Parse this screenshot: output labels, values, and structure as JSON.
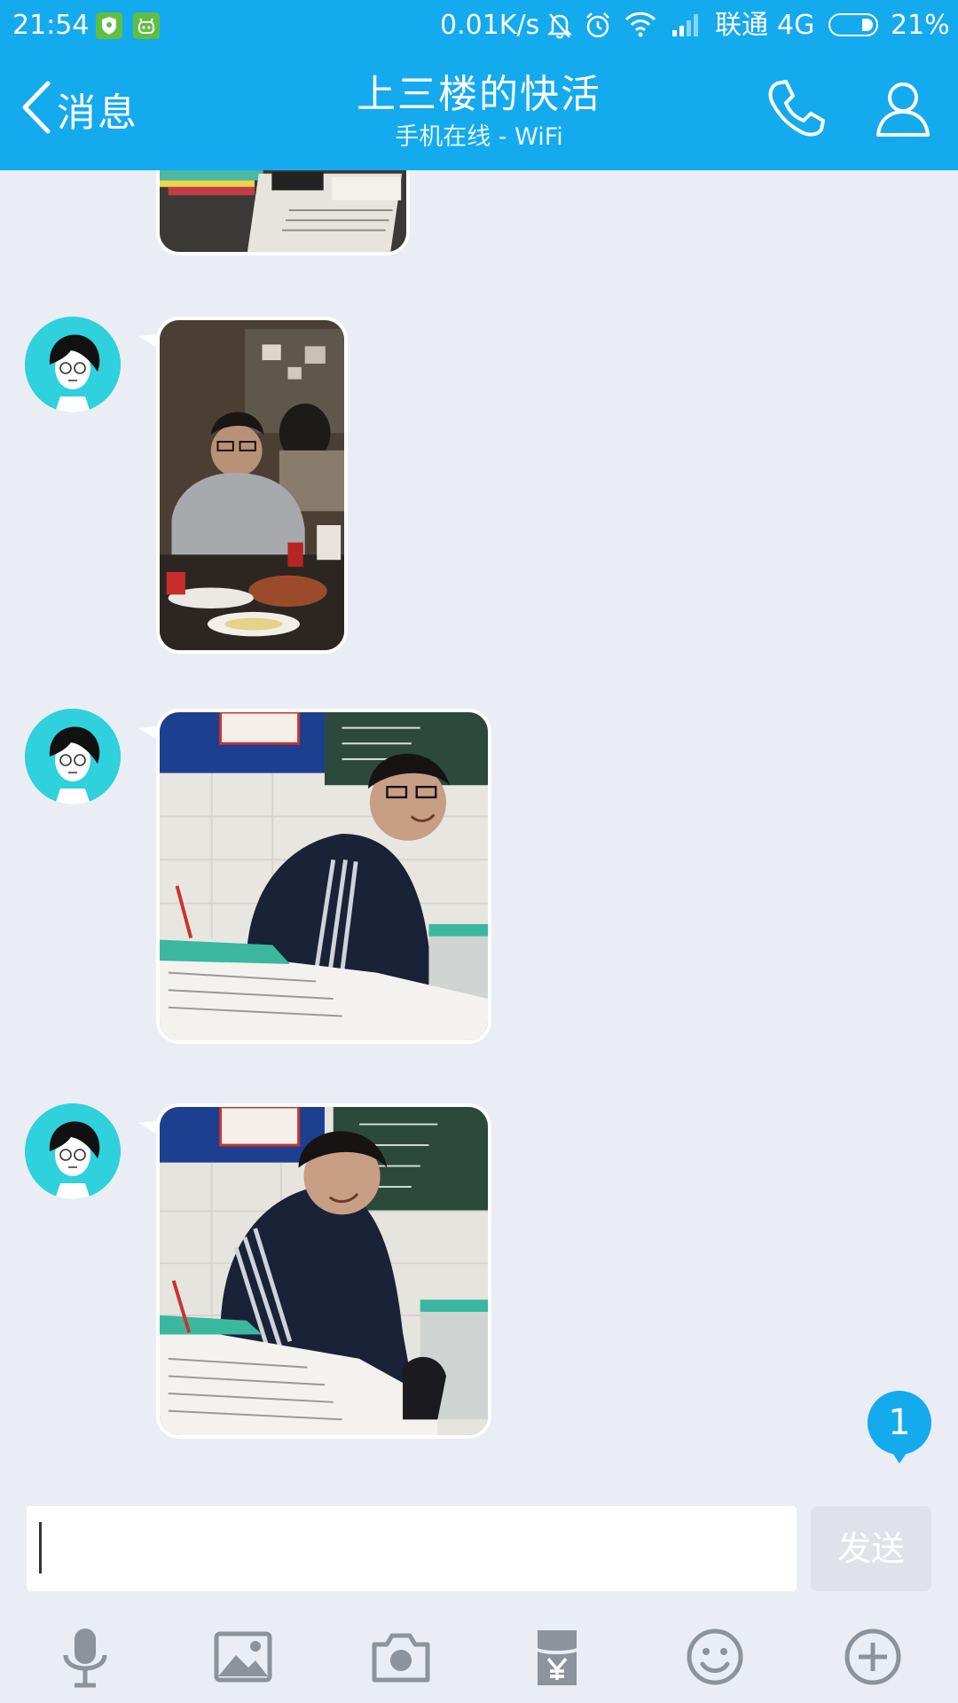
{
  "status_bar": {
    "time": "21:54",
    "net_speed": "0.01K/s",
    "carrier": "联通",
    "network_type": "4G",
    "battery_percent": "21%",
    "battery_level": 0.21,
    "icons": [
      "shield-app-icon",
      "robot-app-icon",
      "mute-bell-icon",
      "alarm-icon",
      "wifi-icon",
      "signal-icon",
      "battery-icon"
    ]
  },
  "header": {
    "back_label": "消息",
    "title": "上三楼的快活",
    "subtitle": "手机在线 - WiFi",
    "actions": [
      "phone-icon",
      "profile-icon"
    ]
  },
  "messages": [
    {
      "type": "image",
      "sender": "contact",
      "content": "classroom desk with pencil case and papers (partially visible)"
    },
    {
      "type": "image",
      "sender": "contact",
      "content": "boy with glasses at dinner table"
    },
    {
      "type": "image",
      "sender": "contact",
      "content": "boy in navy hoodie in classroom, smiling"
    },
    {
      "type": "image",
      "sender": "contact",
      "content": "boy in navy hoodie in classroom, looking down"
    }
  ],
  "unread_badge": "1",
  "composer": {
    "input_value": "",
    "send_label": "发送",
    "toolbar": [
      "microphone-icon",
      "image-icon",
      "camera-icon",
      "red-packet-icon",
      "emoji-icon",
      "plus-icon"
    ]
  },
  "colors": {
    "accent": "#14aaee",
    "background": "#eaedf4",
    "avatar_bg": "#2fd1dd",
    "send_disabled": "#dfe3e9"
  }
}
